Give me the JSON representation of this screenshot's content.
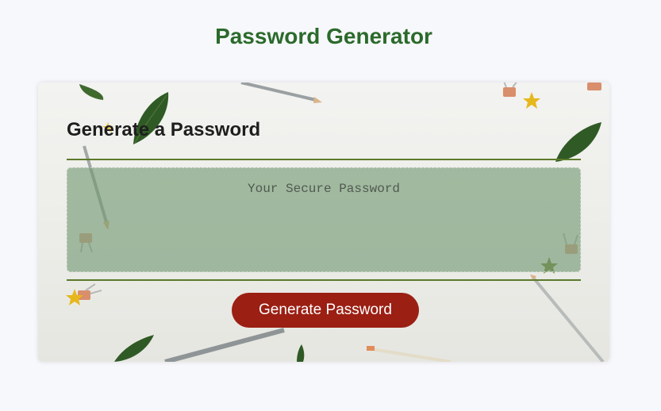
{
  "page": {
    "title": "Password Generator"
  },
  "card": {
    "header": "Generate a Password",
    "password_value": "",
    "password_placeholder": "Your Secure Password",
    "generate_label": "Generate Password"
  },
  "colors": {
    "title": "#2b6a2b",
    "accent_rule": "#5c7a2a",
    "button": "#9b1f13",
    "password_box": "#719871",
    "page_background": "#f7f8fc"
  },
  "decorations": [
    "leaf-icon",
    "pencil-icon",
    "binder-clip-icon",
    "star-icon"
  ]
}
